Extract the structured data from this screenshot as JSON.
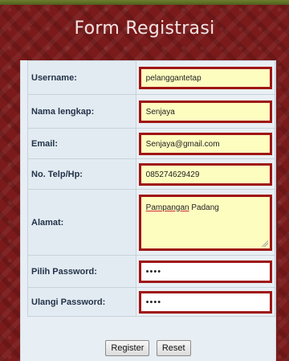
{
  "header": {
    "title": "Form Registrasi"
  },
  "form": {
    "fields": [
      {
        "label": "Username:",
        "value": "pelanggantetap"
      },
      {
        "label": "Nama lengkap:",
        "value": "Senjaya"
      },
      {
        "label": "Email:",
        "value": "Senjaya@gmail.com"
      },
      {
        "label": "No. Telp/Hp:",
        "value": "085274629429"
      },
      {
        "label": "Alamat:",
        "value_word1": "Pampangan",
        "value_word2": " Padang"
      },
      {
        "label": "Pilih Password:",
        "value": "••••"
      },
      {
        "label": "Ulangi Password:",
        "value": "••••"
      }
    ],
    "buttons": {
      "register": "Register",
      "reset": "Reset"
    }
  },
  "colors": {
    "background": "#7a1a1a",
    "field_border": "#9f1515",
    "field_fill": "#fdfdc0",
    "label_text": "#23324a"
  }
}
